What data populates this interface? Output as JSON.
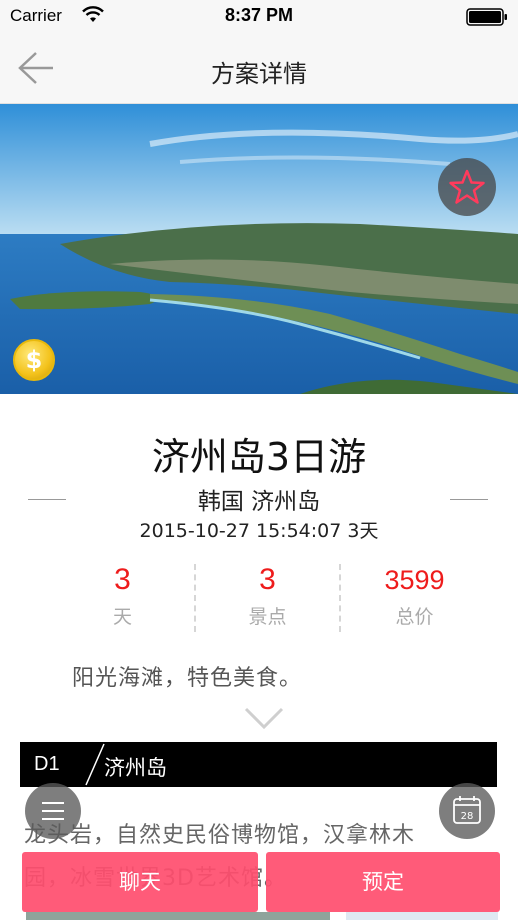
{
  "status_bar": {
    "carrier": "Carrier",
    "time": "8:37 PM"
  },
  "nav": {
    "title": "方案详情"
  },
  "hero": {
    "image_alt_icon": "jeju-coast-photo",
    "favorite_icon": "star-icon",
    "coin_icon": "dollar-coin-icon",
    "coin_symbol": "$"
  },
  "trip": {
    "title": "济州岛3日游",
    "location": "韩国 济州岛",
    "date_line": "2015-10-27 15:54:07  3天"
  },
  "stats": [
    {
      "value": "3",
      "label": "天"
    },
    {
      "value": "3",
      "label": "景点"
    },
    {
      "value": "3599",
      "label": "总价"
    }
  ],
  "description": "阳光海滩，特色美食。",
  "day": {
    "label": "D1",
    "place": "济州岛"
  },
  "spots": {
    "line1": "龙头岩，自然史民俗博物馆，汉拿林木",
    "line2": "园，冰雪世界3D艺术馆。"
  },
  "calendar": {
    "day": "28"
  },
  "actions": {
    "chat": "聊天",
    "book": "预定"
  },
  "colors": {
    "accent": "#ee1c1c",
    "button": "#ff4d6e",
    "day_bar": "#000000"
  }
}
